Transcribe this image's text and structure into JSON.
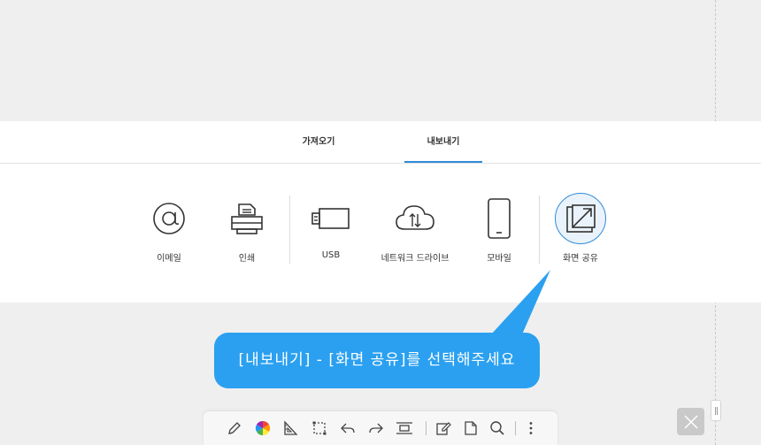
{
  "tabs": [
    {
      "label": "가져오기"
    },
    {
      "label": "내보내기"
    }
  ],
  "options": [
    {
      "label": "이메일",
      "icon": "at-icon"
    },
    {
      "label": "인쇄",
      "icon": "printer-icon"
    },
    {
      "label": "USB",
      "icon": "usb-icon"
    },
    {
      "label": "네트워크 드라이브",
      "icon": "cloud-icon"
    },
    {
      "label": "모바일",
      "icon": "phone-icon"
    },
    {
      "label": "화면 공유",
      "icon": "screen-share-icon"
    }
  ],
  "callout": {
    "text": "[내보내기] - [화면 공유]를 선택해주세요"
  },
  "toolbar": {
    "tools": [
      "pen-icon",
      "color-wheel-icon",
      "ruler-icon",
      "select-icon",
      "undo-icon",
      "redo-icon",
      "page-width-icon",
      "edit-page-icon",
      "page-icon",
      "search-icon",
      "more-icon"
    ]
  },
  "colors": {
    "accent": "#2f8ad8",
    "callout": "#2ba0f0",
    "background": "#efeff0"
  }
}
